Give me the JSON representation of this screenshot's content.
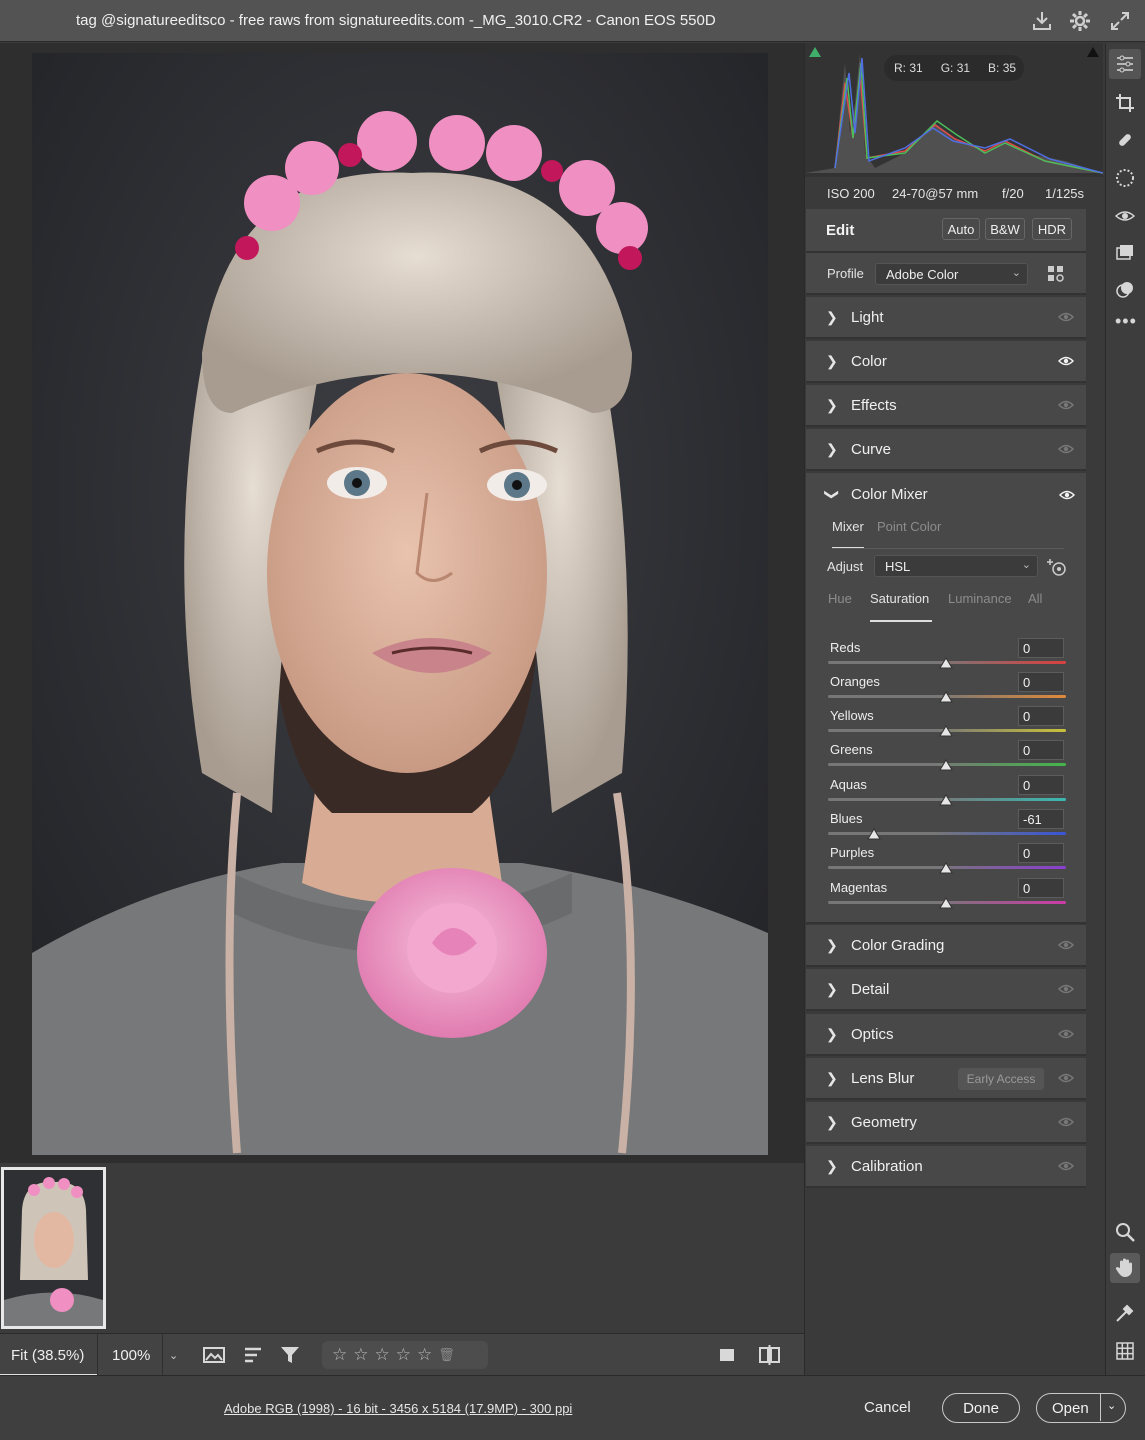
{
  "window": {
    "title": "tag @signatureeditsco - free raws from signatureedits.com -_MG_3010.CR2  -  Canon EOS 550D"
  },
  "histogram": {
    "r_label": "R: 31",
    "g_label": "G: 31",
    "b_label": "B: 35"
  },
  "exif": {
    "iso": "ISO 200",
    "lens": "24-70@57 mm",
    "aperture": "f/20",
    "shutter": "1/125s"
  },
  "edit": {
    "title": "Edit",
    "auto": "Auto",
    "bw": "B&W",
    "hdr": "HDR",
    "profile_label": "Profile",
    "profile_value": "Adobe Color"
  },
  "sections_top": [
    {
      "label": "Light"
    },
    {
      "label": "Color"
    },
    {
      "label": "Effects"
    },
    {
      "label": "Curve"
    }
  ],
  "color_mixer": {
    "title": "Color Mixer",
    "tab_mixer": "Mixer",
    "tab_point": "Point Color",
    "adjust_label": "Adjust",
    "adjust_value": "HSL",
    "subtabs": [
      "Hue",
      "Saturation",
      "Luminance",
      "All"
    ],
    "sliders": [
      {
        "label": "Reds",
        "value": "0"
      },
      {
        "label": "Oranges",
        "value": "0"
      },
      {
        "label": "Yellows",
        "value": "0"
      },
      {
        "label": "Greens",
        "value": "0"
      },
      {
        "label": "Aquas",
        "value": "0"
      },
      {
        "label": "Blues",
        "value": "-61"
      },
      {
        "label": "Purples",
        "value": "0"
      },
      {
        "label": "Magentas",
        "value": "0"
      }
    ]
  },
  "sections_bottom": [
    {
      "label": "Color Grading"
    },
    {
      "label": "Detail"
    },
    {
      "label": "Optics"
    },
    {
      "label": "Lens Blur",
      "badge": "Early Access"
    },
    {
      "label": "Geometry"
    },
    {
      "label": "Calibration"
    }
  ],
  "bottom_bar": {
    "fit": "Fit (38.5%)",
    "zoom": "100%"
  },
  "footer": {
    "info": "Adobe RGB (1998) - 16 bit - 3456 x 5184 (17.9MP) - 300 ppi",
    "cancel": "Cancel",
    "done": "Done",
    "open": "Open"
  },
  "colors": {
    "accent_green": "#3fae6a",
    "panel_bg": "#484848"
  }
}
